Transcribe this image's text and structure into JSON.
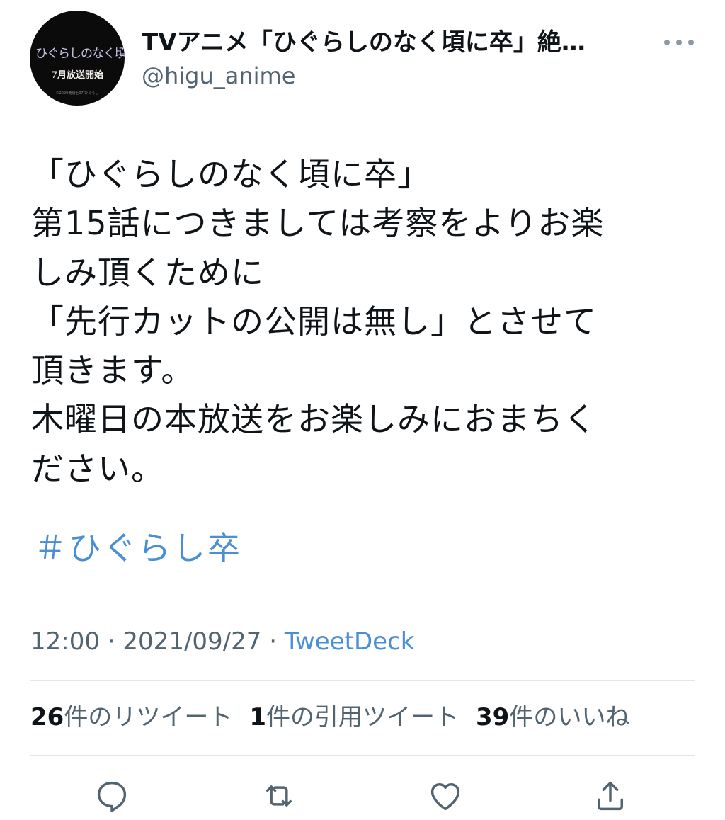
{
  "author": {
    "display_name": "TVアニメ「ひぐらしのなく頃に卒」絶…",
    "handle": "@higu_anime",
    "avatar": {
      "logo_title": "ひぐらしのなく頃に卒",
      "logo_subtitle": "7月放送開始",
      "copyright": "©2020竜騎士07/ひぐらし"
    }
  },
  "icons": {
    "more": "more-icon",
    "reply": "reply-icon",
    "retweet": "retweet-icon",
    "like": "like-icon",
    "share": "share-icon"
  },
  "tweet": {
    "lines": [
      "「ひぐらしのなく頃に卒」",
      "第15話につきましては考察をよりお楽",
      "しみ頂くために",
      "「先行カットの公開は無し」とさせて",
      "頂きます。",
      "木曜日の本放送をお楽しみにおまちく",
      "ださい。"
    ],
    "hashtag": "＃ひぐらし卒"
  },
  "meta": {
    "time": "12:00",
    "separator": " · ",
    "date": "2021/09/27",
    "source": "TweetDeck"
  },
  "stats": {
    "retweets": {
      "count": "26",
      "label": "件のリツイート"
    },
    "quotes": {
      "count": "1",
      "label": "件の引用ツイート"
    },
    "likes": {
      "count": "39",
      "label": "件のいいね"
    }
  },
  "colors": {
    "link": "#4a8fd6",
    "secondary_text": "#536471",
    "primary_text": "#0f1419"
  }
}
